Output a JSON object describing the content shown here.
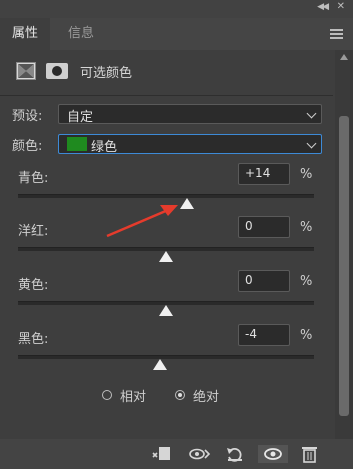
{
  "panel": {
    "tabs": [
      {
        "label": "属性",
        "active": true
      },
      {
        "label": "信息",
        "active": false
      }
    ],
    "title": "可选颜色"
  },
  "preset": {
    "label": "预设:",
    "value": "自定"
  },
  "colors": {
    "label": "颜色:",
    "value": "绿色",
    "swatch_color": "#1f8a1f"
  },
  "sliders": [
    {
      "label": "青色:",
      "value": "+14",
      "percent": 14,
      "unit": "%"
    },
    {
      "label": "洋红:",
      "value": "0",
      "percent": 0,
      "unit": "%"
    },
    {
      "label": "黄色:",
      "value": "0",
      "percent": 0,
      "unit": "%"
    },
    {
      "label": "黑色:",
      "value": "-4",
      "percent": -4,
      "unit": "%"
    }
  ],
  "method": {
    "options": [
      "相对",
      "绝对"
    ],
    "selected": "绝对"
  },
  "bottom_icons": [
    "clip-to-layer-icon",
    "view-previous-icon",
    "reset-icon",
    "visibility-icon",
    "delete-icon"
  ],
  "annotation": {
    "arrow_color": "#e53b2c"
  }
}
